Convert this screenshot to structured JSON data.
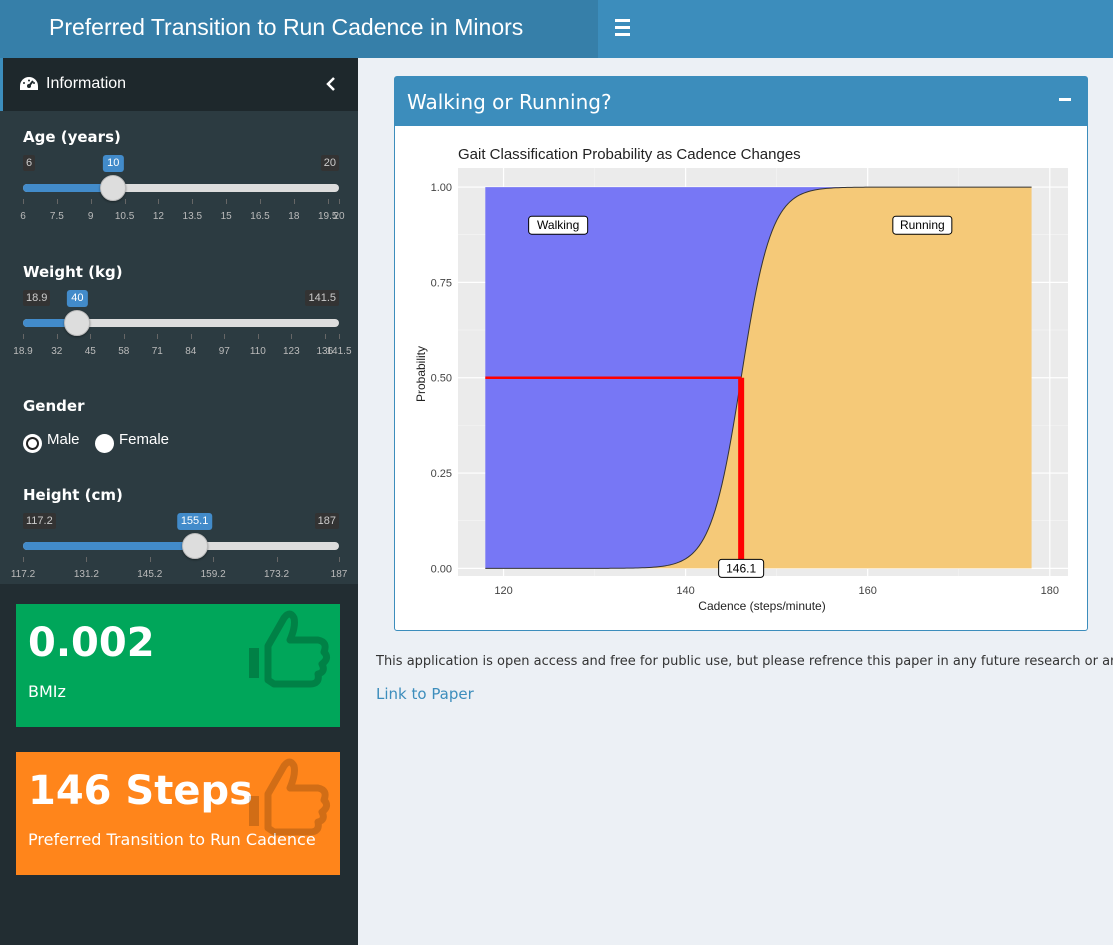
{
  "app": {
    "title": "Preferred Transition to Run Cadence in Minors"
  },
  "sidebar": {
    "menu_item": "Information",
    "age": {
      "label": "Age (years)",
      "min_label": "6",
      "max_label": "20",
      "value_label": "10",
      "min": 6,
      "max": 20,
      "value": 10,
      "ticks": [
        "6",
        "7.5",
        "9",
        "10.5",
        "12",
        "13.5",
        "15",
        "16.5",
        "18",
        "19.5",
        "20"
      ]
    },
    "weight": {
      "label": "Weight (kg)",
      "min_label": "18.9",
      "max_label": "141.5",
      "value_label": "40",
      "min": 18.9,
      "max": 141.5,
      "value": 40,
      "ticks": [
        "18.9",
        "32",
        "45",
        "58",
        "71",
        "84",
        "97",
        "110",
        "123",
        "136",
        "141.5"
      ]
    },
    "gender": {
      "label": "Gender",
      "options": [
        "Male",
        "Female"
      ],
      "selected": "Male"
    },
    "height": {
      "label": "Height (cm)",
      "min_label": "117.2",
      "max_label": "187",
      "value_label": "155.1",
      "min": 117.2,
      "max": 187,
      "value": 155.1,
      "ticks": [
        "117.2",
        "131.2",
        "145.2",
        "159.2",
        "173.2",
        "187"
      ]
    },
    "bmiz": {
      "value": "0.002",
      "label": "BMIz",
      "color": "#00a65a",
      "icon": "thumbs-up-icon"
    },
    "steps": {
      "value": "146 Steps",
      "label": "Preferred Transition to Run Cadence",
      "color": "#ff851b",
      "icon": "thumbs-up-icon"
    }
  },
  "box": {
    "title": "Walking or Running?"
  },
  "chart_data": {
    "type": "area",
    "title": "Gait Classification Probability as Cadence Changes",
    "xlabel": "Cadence (steps/minute)",
    "ylabel": "Probability",
    "xlim": [
      115,
      182
    ],
    "ylim": [
      -0.02,
      1.05
    ],
    "x_ticks": [
      "120",
      "140",
      "160",
      "180"
    ],
    "y_ticks": [
      "0.00",
      "0.25",
      "0.50",
      "0.75",
      "1.00"
    ],
    "x_range": [
      118,
      178
    ],
    "transition_cadence": 146.1,
    "transition_label": "146.1",
    "logistic_slope": 0.6,
    "annotations": [
      {
        "text": "Walking",
        "x": 126,
        "y": 0.9
      },
      {
        "text": "Running",
        "x": 166,
        "y": 0.9
      }
    ],
    "series": [
      {
        "name": "Walking",
        "color": "#7777f5"
      },
      {
        "name": "Running",
        "color": "#f5c978"
      }
    ],
    "marker_color": "#ff0000"
  },
  "footer": {
    "note": "This application is open access and free for public use, but please refrence this paper in any future research or analysis.",
    "link": "Link to Paper"
  }
}
